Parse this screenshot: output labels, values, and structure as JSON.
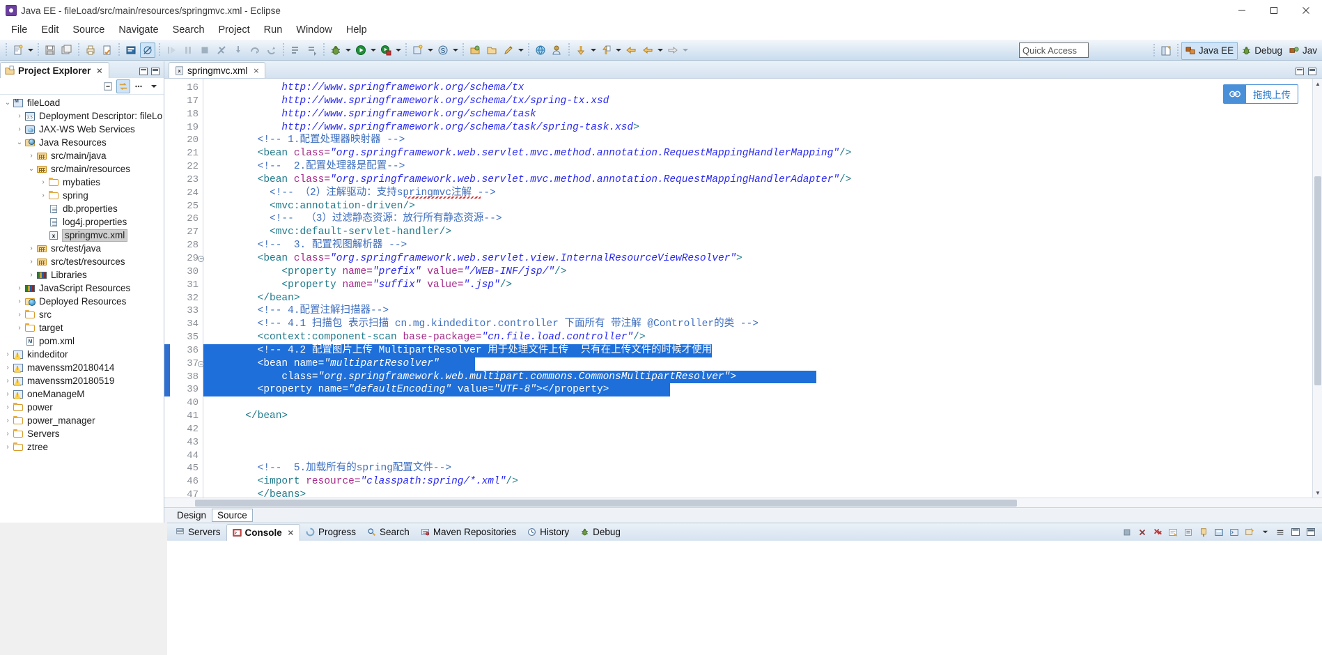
{
  "window": {
    "title": "Java EE - fileLoad/src/main/resources/springmvc.xml - Eclipse",
    "minimize": "─",
    "maximize": "☐",
    "close": "✕"
  },
  "menubar": {
    "items": [
      "File",
      "Edit",
      "Source",
      "Navigate",
      "Search",
      "Project",
      "Run",
      "Window",
      "Help"
    ]
  },
  "toolbar": {
    "quick_access_placeholder": "Quick Access",
    "perspectives": [
      {
        "label": "Java EE",
        "selected": true
      },
      {
        "label": "Debug",
        "selected": false
      },
      {
        "label": "Jav",
        "selected": false
      }
    ]
  },
  "explorer": {
    "tab_label": "Project Explorer",
    "tab_close": "⨯",
    "tree": [
      {
        "depth": 0,
        "twist": "⌄",
        "icon": "project-icon",
        "label": "fileLoad",
        "selected": false
      },
      {
        "depth": 1,
        "twist": "›",
        "icon": "deployment-descriptor-icon",
        "label": "Deployment Descriptor: fileLo",
        "selected": false
      },
      {
        "depth": 1,
        "twist": "›",
        "icon": "web-service-icon",
        "label": "JAX-WS Web Services",
        "selected": false
      },
      {
        "depth": 1,
        "twist": "⌄",
        "icon": "java-resources-icon",
        "label": "Java Resources",
        "selected": false
      },
      {
        "depth": 2,
        "twist": "›",
        "icon": "source-folder-icon",
        "label": "src/main/java",
        "selected": false
      },
      {
        "depth": 2,
        "twist": "⌄",
        "icon": "source-folder-icon",
        "label": "src/main/resources",
        "selected": false
      },
      {
        "depth": 3,
        "twist": "›",
        "icon": "folder-icon",
        "label": "mybaties",
        "selected": false
      },
      {
        "depth": 3,
        "twist": "›",
        "icon": "folder-icon",
        "label": "spring",
        "selected": false
      },
      {
        "depth": 3,
        "twist": "",
        "icon": "properties-file-icon",
        "label": "db.properties",
        "selected": false
      },
      {
        "depth": 3,
        "twist": "",
        "icon": "properties-file-icon",
        "label": "log4j.properties",
        "selected": false
      },
      {
        "depth": 3,
        "twist": "",
        "icon": "xml-file-icon",
        "label": "springmvc.xml",
        "selected": true
      },
      {
        "depth": 2,
        "twist": "›",
        "icon": "source-folder-icon",
        "label": "src/test/java",
        "selected": false
      },
      {
        "depth": 2,
        "twist": "›",
        "icon": "source-folder-icon",
        "label": "src/test/resources",
        "selected": false
      },
      {
        "depth": 2,
        "twist": "›",
        "icon": "libraries-icon",
        "label": "Libraries",
        "selected": false
      },
      {
        "depth": 1,
        "twist": "›",
        "icon": "libraries-icon",
        "label": "JavaScript Resources",
        "selected": false
      },
      {
        "depth": 1,
        "twist": "›",
        "icon": "deployed-resources-icon",
        "label": "Deployed Resources",
        "selected": false
      },
      {
        "depth": 1,
        "twist": "›",
        "icon": "folder-icon",
        "label": "src",
        "selected": false
      },
      {
        "depth": 1,
        "twist": "›",
        "icon": "folder-icon",
        "label": "target",
        "selected": false
      },
      {
        "depth": 1,
        "twist": "",
        "icon": "pom-file-icon",
        "label": "pom.xml",
        "selected": false
      },
      {
        "depth": 0,
        "twist": "›",
        "icon": "project-warning-icon",
        "label": "kindeditor",
        "selected": false
      },
      {
        "depth": 0,
        "twist": "›",
        "icon": "project-warning-icon",
        "label": "mavenssm20180414",
        "selected": false
      },
      {
        "depth": 0,
        "twist": "›",
        "icon": "project-warning-icon",
        "label": "mavenssm20180519",
        "selected": false
      },
      {
        "depth": 0,
        "twist": "›",
        "icon": "project-warning-icon",
        "label": "oneManageM",
        "selected": false
      },
      {
        "depth": 0,
        "twist": "›",
        "icon": "folder-icon",
        "label": "power",
        "selected": false
      },
      {
        "depth": 0,
        "twist": "›",
        "icon": "folder-icon",
        "label": "power_manager",
        "selected": false
      },
      {
        "depth": 0,
        "twist": "›",
        "icon": "folder-icon",
        "label": "Servers",
        "selected": false
      },
      {
        "depth": 0,
        "twist": "›",
        "icon": "folder-icon",
        "label": "ztree",
        "selected": false
      }
    ]
  },
  "editor": {
    "tab_label": "springmvc.xml",
    "tab_close": "⨯",
    "design_tab": "Design",
    "source_tab": "Source",
    "upload_widget_label": "拖拽上传",
    "first_line_number": 16,
    "lines": [
      {
        "n": 16,
        "fold": false,
        "sel": false,
        "tokens": [
          {
            "c": "txt",
            "t": "            http://www.springframework.org/schema/tx"
          }
        ]
      },
      {
        "n": 17,
        "fold": false,
        "sel": false,
        "tokens": [
          {
            "c": "txt",
            "t": "            http://www.springframework.org/schema/tx/spring-tx.xsd"
          }
        ]
      },
      {
        "n": 18,
        "fold": false,
        "sel": false,
        "tokens": [
          {
            "c": "txt",
            "t": "            http://www.springframework.org/schema/task"
          }
        ]
      },
      {
        "n": 19,
        "fold": false,
        "sel": false,
        "tokens": [
          {
            "c": "txt",
            "t": "            http://www.springframework.org/schema/task/spring-task.xsd"
          },
          {
            "c": "tag",
            "t": ">"
          }
        ]
      },
      {
        "n": 20,
        "fold": false,
        "sel": false,
        "tokens": [
          {
            "c": "cmt",
            "t": "        <!-- 1.配置处理器映射器 -->"
          }
        ]
      },
      {
        "n": 21,
        "fold": false,
        "sel": false,
        "tokens": [
          {
            "c": "tag",
            "t": "        <bean "
          },
          {
            "c": "attr",
            "t": "class="
          },
          {
            "c": "val",
            "t": "\"org.springframework.web.servlet.mvc.method.annotation.RequestMappingHandlerMapping\""
          },
          {
            "c": "tag",
            "t": "/>"
          }
        ]
      },
      {
        "n": 22,
        "fold": false,
        "sel": false,
        "tokens": [
          {
            "c": "cmt",
            "t": "        <!--  2.配置处理器是配置-->"
          }
        ]
      },
      {
        "n": 23,
        "fold": false,
        "sel": false,
        "tokens": [
          {
            "c": "tag",
            "t": "        <bean "
          },
          {
            "c": "attr",
            "t": "class="
          },
          {
            "c": "val",
            "t": "\"org.springframework.web.servlet.mvc.method.annotation.RequestMappingHandlerAdapter\""
          },
          {
            "c": "tag",
            "t": "/>"
          }
        ]
      },
      {
        "n": 24,
        "fold": false,
        "sel": false,
        "tokens": [
          {
            "c": "cmt",
            "t": "          <!-- （2）注解驱动：支持springmvc注解 -->"
          }
        ]
      },
      {
        "n": 25,
        "fold": false,
        "sel": false,
        "tokens": [
          {
            "c": "tag",
            "t": "          <mvc:annotation-driven/>"
          }
        ]
      },
      {
        "n": 26,
        "fold": false,
        "sel": false,
        "tokens": [
          {
            "c": "cmt",
            "t": "          <!--  （3）过滤静态资源：放行所有静态资源-->"
          }
        ]
      },
      {
        "n": 27,
        "fold": false,
        "sel": false,
        "tokens": [
          {
            "c": "tag",
            "t": "          <mvc:default-servlet-handler/>"
          }
        ]
      },
      {
        "n": 28,
        "fold": false,
        "sel": false,
        "tokens": [
          {
            "c": "cmt",
            "t": "        <!--  3. 配置视图解析器 -->"
          }
        ]
      },
      {
        "n": 29,
        "fold": true,
        "sel": false,
        "tokens": [
          {
            "c": "tag",
            "t": "        <bean "
          },
          {
            "c": "attr",
            "t": "class="
          },
          {
            "c": "val",
            "t": "\"org.springframework.web.servlet.view.InternalResourceViewResolver\""
          },
          {
            "c": "tag",
            "t": ">"
          }
        ]
      },
      {
        "n": 30,
        "fold": false,
        "sel": false,
        "tokens": [
          {
            "c": "tag",
            "t": "            <property "
          },
          {
            "c": "attr",
            "t": "name="
          },
          {
            "c": "val",
            "t": "\"prefix\""
          },
          {
            "c": "plain",
            "t": " "
          },
          {
            "c": "attr",
            "t": "value="
          },
          {
            "c": "val",
            "t": "\"/WEB-INF/jsp/\""
          },
          {
            "c": "tag",
            "t": "/>"
          }
        ]
      },
      {
        "n": 31,
        "fold": false,
        "sel": false,
        "tokens": [
          {
            "c": "tag",
            "t": "            <property "
          },
          {
            "c": "attr",
            "t": "name="
          },
          {
            "c": "val",
            "t": "\"suffix\""
          },
          {
            "c": "plain",
            "t": " "
          },
          {
            "c": "attr",
            "t": "value="
          },
          {
            "c": "val",
            "t": "\".jsp\""
          },
          {
            "c": "tag",
            "t": "/>"
          }
        ]
      },
      {
        "n": 32,
        "fold": false,
        "sel": false,
        "tokens": [
          {
            "c": "tag",
            "t": "        </bean>"
          }
        ]
      },
      {
        "n": 33,
        "fold": false,
        "sel": false,
        "tokens": [
          {
            "c": "cmt",
            "t": "        <!-- 4.配置注解扫描器-->"
          }
        ]
      },
      {
        "n": 34,
        "fold": false,
        "sel": false,
        "tokens": [
          {
            "c": "cmt",
            "t": "        <!-- 4.1 扫描包 表示扫描 cn.mg.kindeditor.controller 下面所有 带注解 @Controller的类 -->"
          }
        ]
      },
      {
        "n": 35,
        "fold": false,
        "sel": false,
        "tokens": [
          {
            "c": "tag",
            "t": "        <context:component-scan "
          },
          {
            "c": "attr",
            "t": "base-package="
          },
          {
            "c": "val",
            "t": "\"cn.file.load.controller\""
          },
          {
            "c": "tag",
            "t": "/>"
          }
        ]
      },
      {
        "n": 36,
        "fold": false,
        "sel": true,
        "tokens": [
          {
            "c": "cmt",
            "t": "        <!-- 4.2 配置图片上传 MultipartResolver 用于处理文件上传  只有在上传文件的时候才使用 -->"
          }
        ]
      },
      {
        "n": 37,
        "fold": true,
        "sel": true,
        "tokens": [
          {
            "c": "tag",
            "t": "        <bean "
          },
          {
            "c": "attr",
            "t": "name="
          },
          {
            "c": "val",
            "t": "\"multipartResolver\""
          }
        ]
      },
      {
        "n": 38,
        "fold": false,
        "sel": true,
        "tokens": [
          {
            "c": "attr",
            "t": "            class="
          },
          {
            "c": "val",
            "t": "\"org.springframework.web.multipart.commons.CommonsMultipartResolver\""
          },
          {
            "c": "tag",
            "t": ">"
          }
        ]
      },
      {
        "n": 39,
        "fold": false,
        "sel": true,
        "tokens": [
          {
            "c": "tag",
            "t": "        <property "
          },
          {
            "c": "attr",
            "t": "name="
          },
          {
            "c": "val",
            "t": "\"defaultEncoding\""
          },
          {
            "c": "plain",
            "t": " "
          },
          {
            "c": "attr",
            "t": "value="
          },
          {
            "c": "val",
            "t": "\"UTF-8\""
          },
          {
            "c": "tag",
            "t": "></property>"
          }
        ]
      },
      {
        "n": 40,
        "fold": false,
        "sel": false,
        "tokens": [
          {
            "c": "plain",
            "t": ""
          }
        ]
      },
      {
        "n": 41,
        "fold": false,
        "sel": false,
        "tokens": [
          {
            "c": "tag",
            "t": "      </bean>"
          }
        ]
      },
      {
        "n": 42,
        "fold": false,
        "sel": false,
        "tokens": [
          {
            "c": "plain",
            "t": ""
          }
        ]
      },
      {
        "n": 43,
        "fold": false,
        "sel": false,
        "tokens": [
          {
            "c": "plain",
            "t": ""
          }
        ]
      },
      {
        "n": 44,
        "fold": false,
        "sel": false,
        "tokens": [
          {
            "c": "plain",
            "t": ""
          }
        ]
      },
      {
        "n": 45,
        "fold": false,
        "sel": false,
        "tokens": [
          {
            "c": "cmt",
            "t": "        <!--  5.加载所有的spring配置文件-->"
          }
        ]
      },
      {
        "n": 46,
        "fold": false,
        "sel": false,
        "tokens": [
          {
            "c": "tag",
            "t": "        <import "
          },
          {
            "c": "attr",
            "t": "resource="
          },
          {
            "c": "val",
            "t": "\"classpath:spring/*.xml\""
          },
          {
            "c": "tag",
            "t": "/>"
          }
        ]
      },
      {
        "n": 47,
        "fold": false,
        "sel": false,
        "tokens": [
          {
            "c": "tag",
            "t": "        </beans>"
          }
        ]
      }
    ]
  },
  "bottom_view": {
    "tabs": [
      {
        "label": "Servers",
        "icon": "servers-icon",
        "selected": false,
        "close": ""
      },
      {
        "label": "Console",
        "icon": "console-icon",
        "selected": true,
        "close": "⨯"
      },
      {
        "label": "Progress",
        "icon": "progress-icon",
        "selected": false,
        "close": ""
      },
      {
        "label": "Search",
        "icon": "search-icon",
        "selected": false,
        "close": ""
      },
      {
        "label": "Maven Repositories",
        "icon": "maven-icon",
        "selected": false,
        "close": ""
      },
      {
        "label": "History",
        "icon": "history-icon",
        "selected": false,
        "close": ""
      },
      {
        "label": "Debug",
        "icon": "debug-icon",
        "selected": false,
        "close": ""
      }
    ]
  },
  "colors": {
    "accent": "#1e6fd9",
    "tag": "#1f7a8c",
    "attribute": "#a52a8a",
    "value": "#2a2af0",
    "comment": "#3f6fbf",
    "selection_bg": "#1e6fd9",
    "toolbar_gradient_top": "#f3f7fb",
    "toolbar_gradient_bottom": "#c9dcee"
  }
}
